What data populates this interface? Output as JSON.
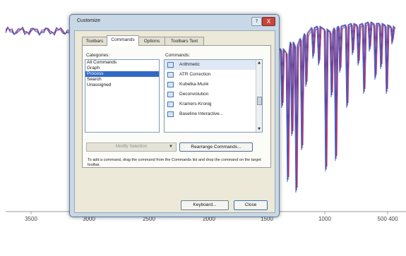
{
  "chart_data": {
    "type": "line",
    "x_axis_ticks": [
      "3500",
      "3000",
      "2500",
      "2000",
      "1500",
      "1000",
      "500 400"
    ],
    "x_reversed": true,
    "colors": {
      "spectrum_a": "#5a3d9a",
      "spectrum_b": "#c0396b",
      "spectrum_c": "#3f5cc4"
    }
  },
  "dialog": {
    "title": "Customize",
    "help_glyph": "?",
    "close_glyph": "X",
    "tabs": [
      {
        "label": "Toolbars"
      },
      {
        "label": "Commands"
      },
      {
        "label": "Options"
      },
      {
        "label": "Toolbars Text"
      }
    ],
    "categories_label": "Categories:",
    "categories": [
      {
        "label": "All Commands"
      },
      {
        "label": "Graph"
      },
      {
        "label": "Process"
      },
      {
        "label": "Search"
      },
      {
        "label": "Unassigned"
      }
    ],
    "commands_label": "Commands:",
    "commands": [
      {
        "label": "Arithmetic",
        "icon": "arithmetic-icon"
      },
      {
        "label": "ATR Correction",
        "icon": "atr-correction-icon"
      },
      {
        "label": "Kubelka-Munk",
        "icon": "kubelka-munk-icon"
      },
      {
        "label": "Deconvolution",
        "icon": "deconvolution-icon"
      },
      {
        "label": "Kramers-Kronig",
        "icon": "kramers-kronig-icon"
      },
      {
        "label": "Baseline Interactive...",
        "icon": "baseline-interactive-icon"
      }
    ],
    "modify_selection_label": "Modify Selection",
    "rearrange_label": "Rearrange Commands...",
    "help_text": "To add a command, drag the command from the Commands list and drop the command on the target toolbar.",
    "keyboard_label": "Keyboard...",
    "close_label": "Close"
  }
}
